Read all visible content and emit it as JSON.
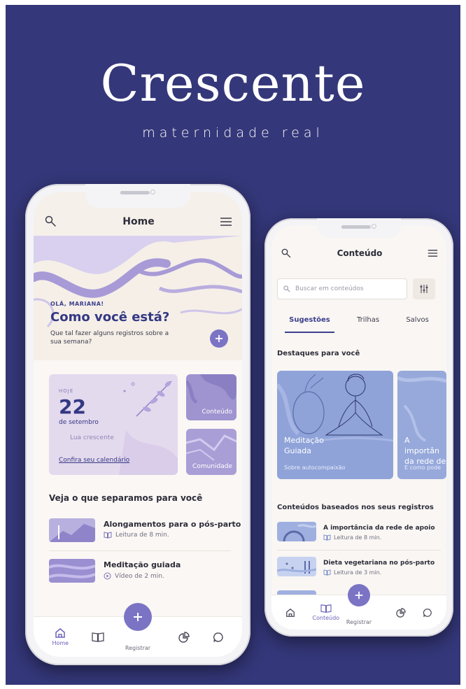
{
  "brand": {
    "name": "Crescente",
    "tagline": "maternidade real"
  },
  "colors": {
    "background": "#343779",
    "accent": "#7b74c4",
    "primary_text": "#343883",
    "card_lilac": "#e4daee",
    "card_blue": "#8fa3d9"
  },
  "home": {
    "title": "Home",
    "greeting": "OLÁ, MARIANA!",
    "question": "Como você está?",
    "subtitle": "Que tal fazer alguns registros sobre a sua semana?",
    "today": {
      "label": "HOJE",
      "day": "22",
      "month": "de setembro",
      "moon": "Lua crescente",
      "link": "Confira seu calendário"
    },
    "tiles": [
      "Conteúdo",
      "Comunidade"
    ],
    "section_title": "Veja o que separamos para você",
    "items": [
      {
        "title": "Alongamentos para o pós-parto",
        "meta": "Leitura de 8 min.",
        "icon": "book-icon"
      },
      {
        "title": "Meditação guiada",
        "meta": "Vídeo de 2 min.",
        "icon": "play-icon"
      }
    ],
    "nav": [
      {
        "label": "Home",
        "icon": "home-icon",
        "active": true
      },
      {
        "label": "",
        "icon": "book-icon",
        "active": false
      },
      {
        "label": "Registrar",
        "icon": "plus-icon",
        "active": false
      },
      {
        "label": "",
        "icon": "chart-icon",
        "active": false
      },
      {
        "label": "",
        "icon": "chat-icon",
        "active": false
      }
    ]
  },
  "content": {
    "title": "Conteúdo",
    "search_placeholder": "Buscar em conteúdos",
    "tabs": [
      "Sugestões",
      "Trilhas",
      "Salvos"
    ],
    "active_tab": "Sugestões",
    "featured_title": "Destaques para você",
    "featured": [
      {
        "title_line1": "Meditação",
        "title_line2": "Guiada",
        "subtitle": "Sobre autocompaixão"
      },
      {
        "title_line1": "A importân",
        "title_line2": "da rede de",
        "subtitle": "E como pode"
      }
    ],
    "records_title": "Conteúdos baseados nos seus registros",
    "items": [
      {
        "title": "A importância da rede de apoio",
        "meta": "Leitura de 8 min."
      },
      {
        "title": "Dieta vegetariana no pós-parto",
        "meta": "Leitura de 3 min."
      }
    ],
    "nav": [
      {
        "label": "",
        "icon": "home-icon",
        "active": false
      },
      {
        "label": "Conteúdo",
        "icon": "book-icon",
        "active": true
      },
      {
        "label": "Registrar",
        "icon": "plus-icon",
        "active": false
      },
      {
        "label": "",
        "icon": "chart-icon",
        "active": false
      },
      {
        "label": "",
        "icon": "chat-icon",
        "active": false
      }
    ]
  }
}
